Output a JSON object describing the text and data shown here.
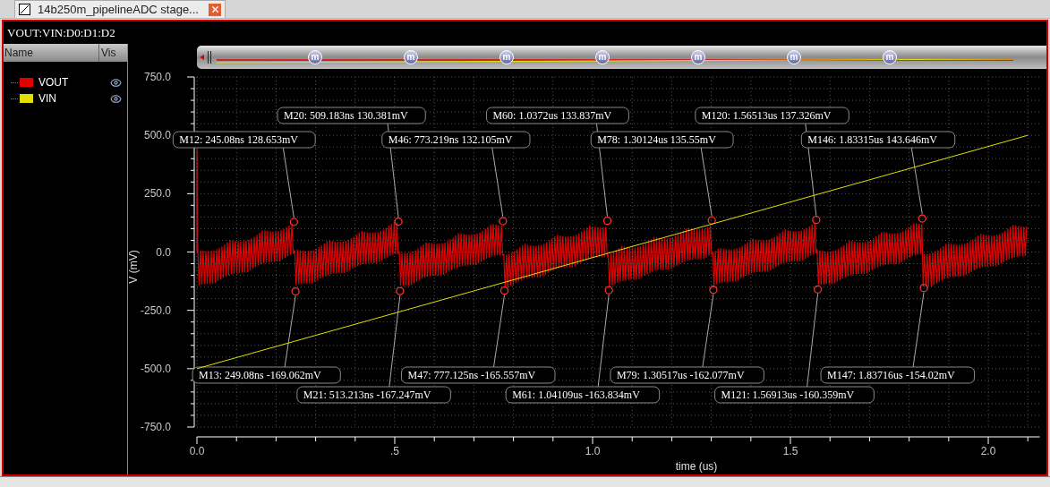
{
  "tab": {
    "title": "14b250m_pipelineADC stage..."
  },
  "window": {
    "title": "VOUT:VIN:D0:D1:D2"
  },
  "legend": {
    "columns": [
      "Name",
      "Vis"
    ],
    "items": [
      {
        "visible": true
      },
      {
        "visible": true
      }
    ]
  },
  "overview": {
    "markers": [
      "m",
      "m",
      "m",
      "m",
      "m",
      "m",
      "m"
    ]
  },
  "chart": {
    "chart_data": {
      "type": "line",
      "xlabel": "time (us)",
      "ylabel": "V (mV)",
      "x": [
        0,
        2.1
      ],
      "series": [
        {
          "name": "VOUT",
          "color": "#e00000",
          "values": [
            null,
            null
          ]
        },
        {
          "name": "VIN",
          "color": "#e0e000",
          "values": [
            -500,
            500
          ]
        }
      ],
      "xlim": [
        0,
        2.13
      ],
      "ylim": [
        -750,
        750
      ],
      "grid": true,
      "xticks": [
        {
          "value": 0,
          "label": "0.0"
        },
        {
          "value": 0.5,
          "label": ".5"
        },
        {
          "value": 1,
          "label": "1.0"
        },
        {
          "value": 1.5,
          "label": "1.5"
        },
        {
          "value": 2,
          "label": "2.0"
        }
      ],
      "yticks": [
        {
          "value": 750,
          "label": "750.0"
        },
        {
          "value": 500,
          "label": "500.0"
        },
        {
          "value": 250,
          "label": "250.0"
        },
        {
          "value": 0,
          "label": "0.0"
        },
        {
          "value": -250,
          "label": "-250.0"
        },
        {
          "value": -500,
          "label": "-500.0"
        },
        {
          "value": -750,
          "label": "-750.0"
        }
      ],
      "annotations": [
        {
          "x": 0.24508,
          "y": 128.653,
          "text": "M12: 245.08ns 128.653mV"
        },
        {
          "x": 0.24908,
          "y": -169.062,
          "text": "M13: 249.08ns -169.062mV"
        },
        {
          "x": 0.509183,
          "y": 130.381,
          "text": "M20: 509.183ns 130.381mV"
        },
        {
          "x": 0.513213,
          "y": -167.247,
          "text": "M21: 513.213ns -167.247mV"
        },
        {
          "x": 0.773219,
          "y": 132.105,
          "text": "M46: 773.219ns 132.105mV"
        },
        {
          "x": 0.777125,
          "y": -165.557,
          "text": "M47: 777.125ns -165.557mV"
        },
        {
          "x": 1.0372,
          "y": 133.837,
          "text": "M60: 1.0372us 133.837mV"
        },
        {
          "x": 1.04109,
          "y": -163.834,
          "text": "M61: 1.04109us -163.834mV"
        },
        {
          "x": 1.30124,
          "y": 135.55,
          "text": "M78: 1.30124us 135.55mV"
        },
        {
          "x": 1.30517,
          "y": -162.077,
          "text": "M79: 1.30517us -162.077mV"
        },
        {
          "x": 1.56513,
          "y": 137.326,
          "text": "M120: 1.56513us 137.326mV"
        },
        {
          "x": 1.56913,
          "y": -160.359,
          "text": "M121: 1.56913us -160.359mV"
        },
        {
          "x": 1.83315,
          "y": 143.646,
          "text": "M146: 1.83315us 143.646mV"
        },
        {
          "x": 1.83716,
          "y": -154.02,
          "text": "M147: 1.83716us -154.02mV"
        }
      ]
    }
  }
}
